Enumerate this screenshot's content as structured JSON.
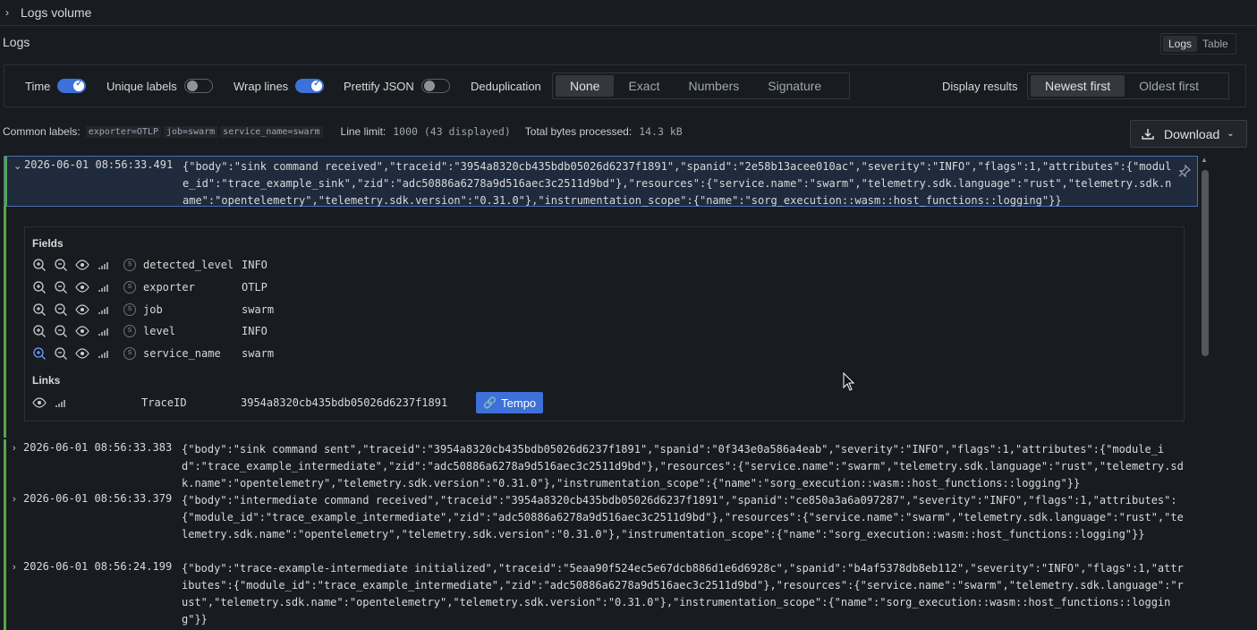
{
  "volume": {
    "title": "Logs volume"
  },
  "logs_title": "Logs",
  "view_toggle": {
    "logs": "Logs",
    "table": "Table"
  },
  "options": {
    "time": "Time",
    "unique_labels": "Unique labels",
    "wrap_lines": "Wrap lines",
    "prettify_json": "Prettify JSON",
    "deduplication": "Deduplication",
    "dedup_modes": [
      "None",
      "Exact",
      "Numbers",
      "Signature"
    ],
    "dedup_selected": "None",
    "display_results": "Display results",
    "sort_modes": [
      "Newest first",
      "Oldest first"
    ],
    "sort_selected": "Newest first",
    "toggles": {
      "time": true,
      "unique_labels": false,
      "wrap_lines": true,
      "prettify_json": false
    }
  },
  "meta": {
    "common_labels_label": "Common labels:",
    "common_labels": [
      "exporter=OTLP",
      "job=swarm",
      "service_name=swarm"
    ],
    "line_limit_label": "Line limit:",
    "line_limit_value": "1000 (43 displayed)",
    "bytes_label": "Total bytes processed:",
    "bytes_value": "14.3 kB"
  },
  "download": {
    "label": "Download"
  },
  "logs": [
    {
      "ts": "2026-06-01 08:56:33.491",
      "line": "{\"body\":\"sink command received\",\"traceid\":\"3954a8320cb435bdb05026d6237f1891\",\"spanid\":\"2e58b13acee010ac\",\"severity\":\"INFO\",\"flags\":1,\"attributes\":{\"module_id\":\"trace_example_sink\",\"zid\":\"adc50886a6278a9d516aec3c2511d9bd\"},\"resources\":{\"service.name\":\"swarm\",\"telemetry.sdk.language\":\"rust\",\"telemetry.sdk.name\":\"opentelemetry\",\"telemetry.sdk.version\":\"0.31.0\"},\"instrumentation_scope\":{\"name\":\"sorg_execution::wasm::host_functions::logging\"}}"
    },
    {
      "ts": "2026-06-01 08:56:33.383",
      "line": "{\"body\":\"sink command sent\",\"traceid\":\"3954a8320cb435bdb05026d6237f1891\",\"spanid\":\"0f343e0a586a4eab\",\"severity\":\"INFO\",\"flags\":1,\"attributes\":{\"module_id\":\"trace_example_intermediate\",\"zid\":\"adc50886a6278a9d516aec3c2511d9bd\"},\"resources\":{\"service.name\":\"swarm\",\"telemetry.sdk.language\":\"rust\",\"telemetry.sdk.name\":\"opentelemetry\",\"telemetry.sdk.version\":\"0.31.0\"},\"instrumentation_scope\":{\"name\":\"sorg_execution::wasm::host_functions::logging\"}}"
    },
    {
      "ts": "2026-06-01 08:56:33.379",
      "line": "{\"body\":\"intermediate command received\",\"traceid\":\"3954a8320cb435bdb05026d6237f1891\",\"spanid\":\"ce850a3a6a097287\",\"severity\":\"INFO\",\"flags\":1,\"attributes\":{\"module_id\":\"trace_example_intermediate\",\"zid\":\"adc50886a6278a9d516aec3c2511d9bd\"},\"resources\":{\"service.name\":\"swarm\",\"telemetry.sdk.language\":\"rust\",\"telemetry.sdk.name\":\"opentelemetry\",\"telemetry.sdk.version\":\"0.31.0\"},\"instrumentation_scope\":{\"name\":\"sorg_execution::wasm::host_functions::logging\"}}"
    },
    {
      "ts": "2026-06-01 08:56:24.199",
      "line": "{\"body\":\"trace-example-intermediate initialized\",\"traceid\":\"5eaa90f524ec5e67dcb886d1e6d6928c\",\"spanid\":\"b4af5378db8eb112\",\"severity\":\"INFO\",\"flags\":1,\"attributes\":{\"module_id\":\"trace_example_intermediate\",\"zid\":\"adc50886a6278a9d516aec3c2511d9bd\"},\"resources\":{\"service.name\":\"swarm\",\"telemetry.sdk.language\":\"rust\",\"telemetry.sdk.name\":\"opentelemetry\",\"telemetry.sdk.version\":\"0.31.0\"},\"instrumentation_scope\":{\"name\":\"sorg_execution::wasm::host_functions::logging\"}}"
    }
  ],
  "details": {
    "fields_heading": "Fields",
    "fields": [
      {
        "name": "detected_level",
        "value": "INFO"
      },
      {
        "name": "exporter",
        "value": "OTLP"
      },
      {
        "name": "job",
        "value": "swarm"
      },
      {
        "name": "level",
        "value": "INFO"
      },
      {
        "name": "service_name",
        "value": "swarm"
      }
    ],
    "links_heading": "Links",
    "link": {
      "name": "TraceID",
      "value": "3954a8320cb435bdb05026d6237f1891",
      "button": "Tempo"
    }
  }
}
